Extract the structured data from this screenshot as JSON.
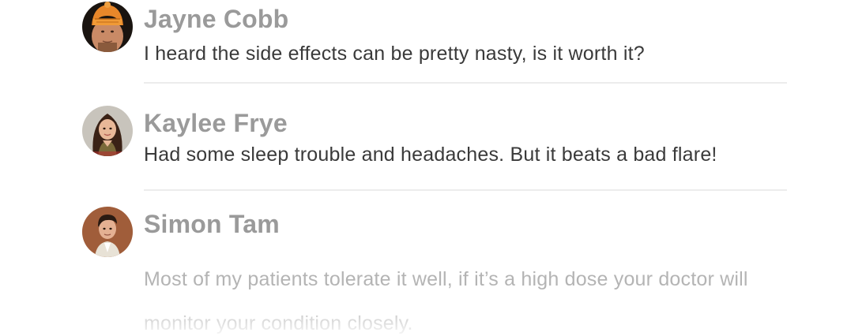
{
  "comments": [
    {
      "author": "Jayne Cobb",
      "text": "I heard the side effects can be pretty nasty, is it worth it?",
      "avatar_icon": "avatar-jayne-cobb"
    },
    {
      "author": "Kaylee Frye",
      "text": "Had some sleep trouble and headaches. But it beats a bad flare!",
      "avatar_icon": "avatar-kaylee-frye"
    },
    {
      "author": "Simon Tam",
      "text": "Most of my patients tolerate it well, if it’s a high dose your doctor will monitor your condition closely.",
      "avatar_icon": "avatar-simon-tam"
    }
  ],
  "colors": {
    "name": "#9a9a9a",
    "text": "#3a3a3a",
    "faded_text": "#b4b4b4",
    "divider": "#ececec"
  }
}
